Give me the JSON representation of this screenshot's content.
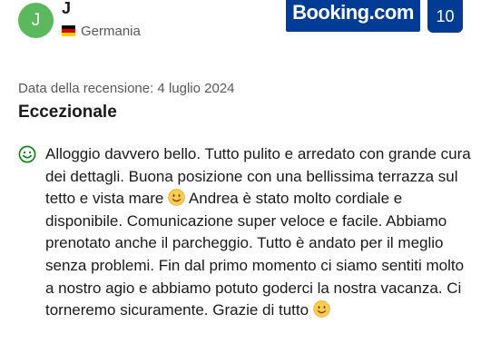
{
  "reviewer": {
    "initial": "J",
    "name": "J",
    "country": "Germania"
  },
  "brand": {
    "logo_text": "Booking.com",
    "score": "10",
    "color": "#003b95"
  },
  "review": {
    "date": "Data della recensione: 4 luglio 2024",
    "title": "Eccezionale",
    "positive_icon": "smile-outline-icon",
    "text_part1": "Alloggio davvero bello. Tutto pulito e arredato con grande cura dei dettagli. Buona posizione con una bellissima terrazza sul tetto e vista mare ",
    "text_part2": " Andrea è stato molto cordiale e disponibile. Comunicazione super veloce e facile. Abbiamo prenotato anche il parcheggio. Tutto è andato per il meglio senza problemi. Fin dal primo momento ci siamo sentiti molto a nostro agio e abbiamo potuto goderci la nostra vacanza. Ci torneremo sicuramente. Grazie di tutto ",
    "emoji": "smiling-face-emoji"
  },
  "colors": {
    "avatar": "#5cb85c",
    "positive_icon": "#008009",
    "muted_text": "#595959"
  }
}
